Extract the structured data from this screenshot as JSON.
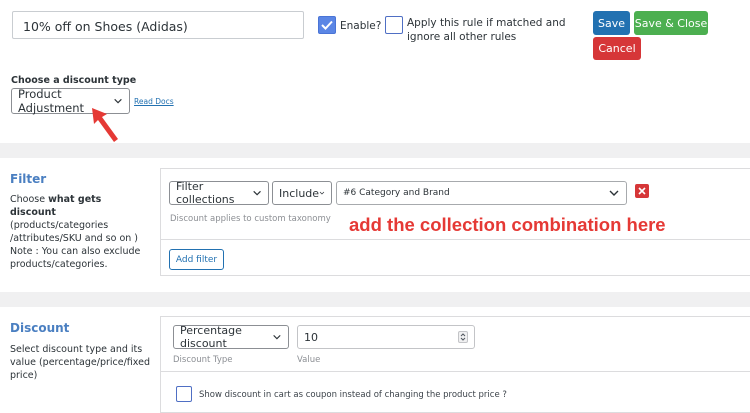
{
  "header": {
    "rule_name": "10% off on Shoes (Adidas)",
    "enable_label": "Enable?",
    "enable_checked": true,
    "exclusive_label": "Apply this rule if matched and ignore all other rules",
    "exclusive_checked": false,
    "save_label": "Save",
    "save_close_label": "Save & Close",
    "cancel_label": "Cancel"
  },
  "discount_type": {
    "label": "Choose a discount type",
    "selected": "Product Adjustment",
    "read_docs": "Read Docs"
  },
  "filter": {
    "title": "Filter",
    "desc_prefix": "Choose ",
    "desc_bold": "what gets discount",
    "desc_rest": "(products/categories /attributes/SKU and so on )",
    "note": "Note : You can also exclude products/categories.",
    "row": {
      "type": "Filter collections",
      "mode": "Include",
      "value": "#6 Category and Brand"
    },
    "help": "Discount applies to custom taxonomy",
    "add_filter": "Add filter",
    "annotation": "add the collection combination here"
  },
  "discount": {
    "title": "Discount",
    "desc": "Select discount type and its value (percentage/price/fixed price)",
    "type_selected": "Percentage discount",
    "value": "10",
    "type_caption": "Discount Type",
    "value_caption": "Value",
    "coupon_label": "Show discount in cart as coupon instead of changing the product price ?",
    "coupon_checked": false
  },
  "colors": {
    "save": "#2271b1",
    "save_close": "#4caf50",
    "cancel": "#d63638",
    "annotation": "#e53935",
    "section_title": "#4a7fc1"
  }
}
